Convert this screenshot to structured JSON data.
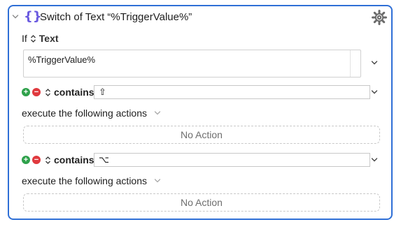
{
  "action": {
    "title": "Switch of Text “%TriggerValue%”",
    "icon_name": "braces-icon",
    "accent": "#2f6fd6",
    "if_label": "If",
    "source_label": "Text",
    "text_value": "%TriggerValue%"
  },
  "cases": [
    {
      "condition_label": "contains",
      "value": "⇧",
      "execute_label": "execute the following actions",
      "actions_placeholder": "No Action"
    },
    {
      "condition_label": "contains",
      "value": "⌥",
      "execute_label": "execute the following actions",
      "actions_placeholder": "No Action"
    }
  ]
}
